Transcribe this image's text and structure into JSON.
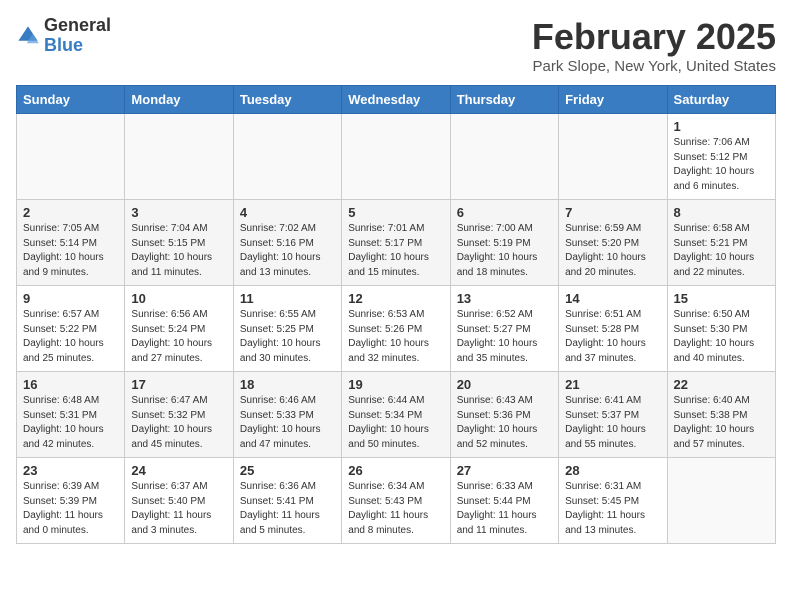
{
  "header": {
    "logo_general": "General",
    "logo_blue": "Blue",
    "title": "February 2025",
    "subtitle": "Park Slope, New York, United States"
  },
  "calendar": {
    "days_of_week": [
      "Sunday",
      "Monday",
      "Tuesday",
      "Wednesday",
      "Thursday",
      "Friday",
      "Saturday"
    ],
    "weeks": [
      [
        {
          "day": "",
          "info": ""
        },
        {
          "day": "",
          "info": ""
        },
        {
          "day": "",
          "info": ""
        },
        {
          "day": "",
          "info": ""
        },
        {
          "day": "",
          "info": ""
        },
        {
          "day": "",
          "info": ""
        },
        {
          "day": "1",
          "info": "Sunrise: 7:06 AM\nSunset: 5:12 PM\nDaylight: 10 hours and 6 minutes."
        }
      ],
      [
        {
          "day": "2",
          "info": "Sunrise: 7:05 AM\nSunset: 5:14 PM\nDaylight: 10 hours and 9 minutes."
        },
        {
          "day": "3",
          "info": "Sunrise: 7:04 AM\nSunset: 5:15 PM\nDaylight: 10 hours and 11 minutes."
        },
        {
          "day": "4",
          "info": "Sunrise: 7:02 AM\nSunset: 5:16 PM\nDaylight: 10 hours and 13 minutes."
        },
        {
          "day": "5",
          "info": "Sunrise: 7:01 AM\nSunset: 5:17 PM\nDaylight: 10 hours and 15 minutes."
        },
        {
          "day": "6",
          "info": "Sunrise: 7:00 AM\nSunset: 5:19 PM\nDaylight: 10 hours and 18 minutes."
        },
        {
          "day": "7",
          "info": "Sunrise: 6:59 AM\nSunset: 5:20 PM\nDaylight: 10 hours and 20 minutes."
        },
        {
          "day": "8",
          "info": "Sunrise: 6:58 AM\nSunset: 5:21 PM\nDaylight: 10 hours and 22 minutes."
        }
      ],
      [
        {
          "day": "9",
          "info": "Sunrise: 6:57 AM\nSunset: 5:22 PM\nDaylight: 10 hours and 25 minutes."
        },
        {
          "day": "10",
          "info": "Sunrise: 6:56 AM\nSunset: 5:24 PM\nDaylight: 10 hours and 27 minutes."
        },
        {
          "day": "11",
          "info": "Sunrise: 6:55 AM\nSunset: 5:25 PM\nDaylight: 10 hours and 30 minutes."
        },
        {
          "day": "12",
          "info": "Sunrise: 6:53 AM\nSunset: 5:26 PM\nDaylight: 10 hours and 32 minutes."
        },
        {
          "day": "13",
          "info": "Sunrise: 6:52 AM\nSunset: 5:27 PM\nDaylight: 10 hours and 35 minutes."
        },
        {
          "day": "14",
          "info": "Sunrise: 6:51 AM\nSunset: 5:28 PM\nDaylight: 10 hours and 37 minutes."
        },
        {
          "day": "15",
          "info": "Sunrise: 6:50 AM\nSunset: 5:30 PM\nDaylight: 10 hours and 40 minutes."
        }
      ],
      [
        {
          "day": "16",
          "info": "Sunrise: 6:48 AM\nSunset: 5:31 PM\nDaylight: 10 hours and 42 minutes."
        },
        {
          "day": "17",
          "info": "Sunrise: 6:47 AM\nSunset: 5:32 PM\nDaylight: 10 hours and 45 minutes."
        },
        {
          "day": "18",
          "info": "Sunrise: 6:46 AM\nSunset: 5:33 PM\nDaylight: 10 hours and 47 minutes."
        },
        {
          "day": "19",
          "info": "Sunrise: 6:44 AM\nSunset: 5:34 PM\nDaylight: 10 hours and 50 minutes."
        },
        {
          "day": "20",
          "info": "Sunrise: 6:43 AM\nSunset: 5:36 PM\nDaylight: 10 hours and 52 minutes."
        },
        {
          "day": "21",
          "info": "Sunrise: 6:41 AM\nSunset: 5:37 PM\nDaylight: 10 hours and 55 minutes."
        },
        {
          "day": "22",
          "info": "Sunrise: 6:40 AM\nSunset: 5:38 PM\nDaylight: 10 hours and 57 minutes."
        }
      ],
      [
        {
          "day": "23",
          "info": "Sunrise: 6:39 AM\nSunset: 5:39 PM\nDaylight: 11 hours and 0 minutes."
        },
        {
          "day": "24",
          "info": "Sunrise: 6:37 AM\nSunset: 5:40 PM\nDaylight: 11 hours and 3 minutes."
        },
        {
          "day": "25",
          "info": "Sunrise: 6:36 AM\nSunset: 5:41 PM\nDaylight: 11 hours and 5 minutes."
        },
        {
          "day": "26",
          "info": "Sunrise: 6:34 AM\nSunset: 5:43 PM\nDaylight: 11 hours and 8 minutes."
        },
        {
          "day": "27",
          "info": "Sunrise: 6:33 AM\nSunset: 5:44 PM\nDaylight: 11 hours and 11 minutes."
        },
        {
          "day": "28",
          "info": "Sunrise: 6:31 AM\nSunset: 5:45 PM\nDaylight: 11 hours and 13 minutes."
        },
        {
          "day": "",
          "info": ""
        }
      ]
    ]
  }
}
